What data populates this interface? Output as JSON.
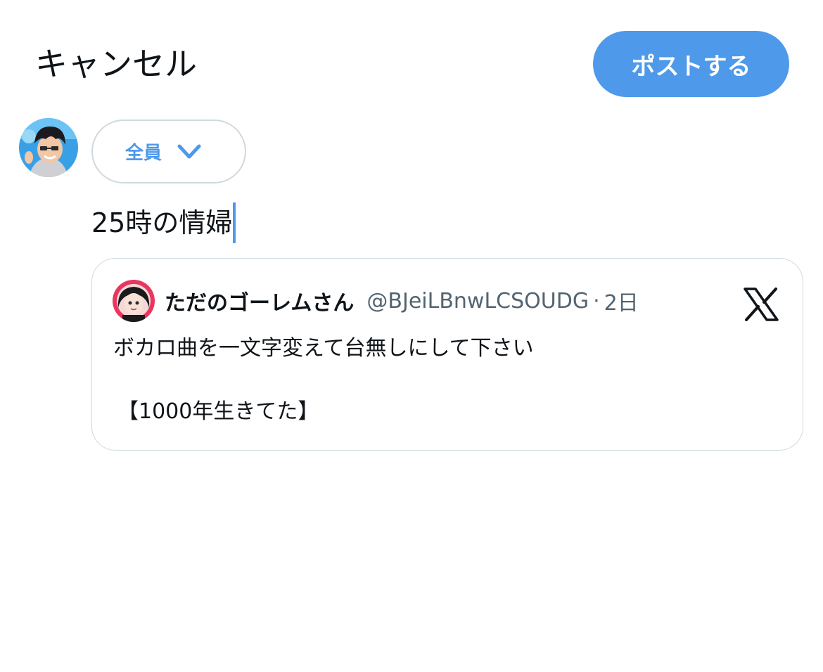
{
  "header": {
    "cancel_label": "キャンセル",
    "post_label": "ポストする"
  },
  "composer": {
    "audience_label": "全員",
    "text": "25時の情婦"
  },
  "quoted_post": {
    "display_name": "ただのゴーレムさん",
    "handle": "@BJeiLBnwLCSOUDG",
    "separator": "·",
    "time": "2日",
    "line1": "ボカロ曲を一文字変えて台無しにして下さい",
    "line2": "【1000年生きてた】"
  },
  "icons": {
    "audience": "chevron-down-icon",
    "platform": "x-logo-icon"
  },
  "colors": {
    "accent": "#4e99ea",
    "text": "#0f1419",
    "muted": "#536471",
    "border": "#cfd9de"
  }
}
